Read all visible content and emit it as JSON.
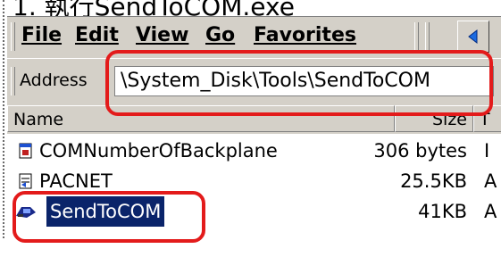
{
  "heading": {
    "text": "1. 執行SendToCOM.exe"
  },
  "menubar": {
    "items": [
      {
        "label": "File"
      },
      {
        "label": "Edit"
      },
      {
        "label": "View"
      },
      {
        "label": "Go"
      },
      {
        "label": "Favorites"
      }
    ],
    "back_icon": "back-arrow-icon"
  },
  "addressbar": {
    "label": "Address",
    "value": "\\System_Disk\\Tools\\SendToCOM"
  },
  "list": {
    "columns": [
      {
        "label": "Name"
      },
      {
        "label": "Size"
      },
      {
        "label": "T"
      }
    ],
    "rows": [
      {
        "name": "COMNumberOfBackplane",
        "size": "306 bytes",
        "type": "I",
        "icon": "script-file-icon"
      },
      {
        "name": "PACNET",
        "size": "25.5KB",
        "type": "A",
        "icon": "application-file-icon"
      },
      {
        "name": "SendToCOM",
        "size": "41KB",
        "type": "A",
        "icon": "application-exe-icon",
        "selected": true
      }
    ]
  },
  "colors": {
    "highlight_red": "#e31b1b",
    "selection_blue": "#0a246a",
    "window_gray": "#d4d0c8"
  }
}
